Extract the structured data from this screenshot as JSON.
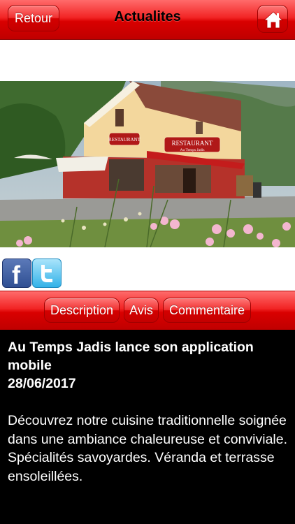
{
  "header": {
    "back_label": "Retour",
    "title": "Actualites",
    "home_icon": "home-icon"
  },
  "photo": {
    "description_icon": "restaurant-photo",
    "sign_main": "RESTAURANT",
    "sign_sub": "Au Temps Jadis"
  },
  "social": {
    "facebook_icon": "facebook-icon",
    "twitter_icon": "twitter-icon"
  },
  "tabs": [
    {
      "label": "Description"
    },
    {
      "label": "Avis"
    },
    {
      "label": "Commentaire"
    }
  ],
  "article": {
    "title": "Au Temps Jadis lance son application mobile",
    "date": "28/06/2017",
    "body": "Découvrez notre cuisine traditionnelle soignée dans une ambiance chaleureuse et conviviale. Spécialités savoyardes. Véranda et terrasse ensoleillées."
  },
  "colors": {
    "accent_red": "#e01010",
    "background": "#000000"
  }
}
